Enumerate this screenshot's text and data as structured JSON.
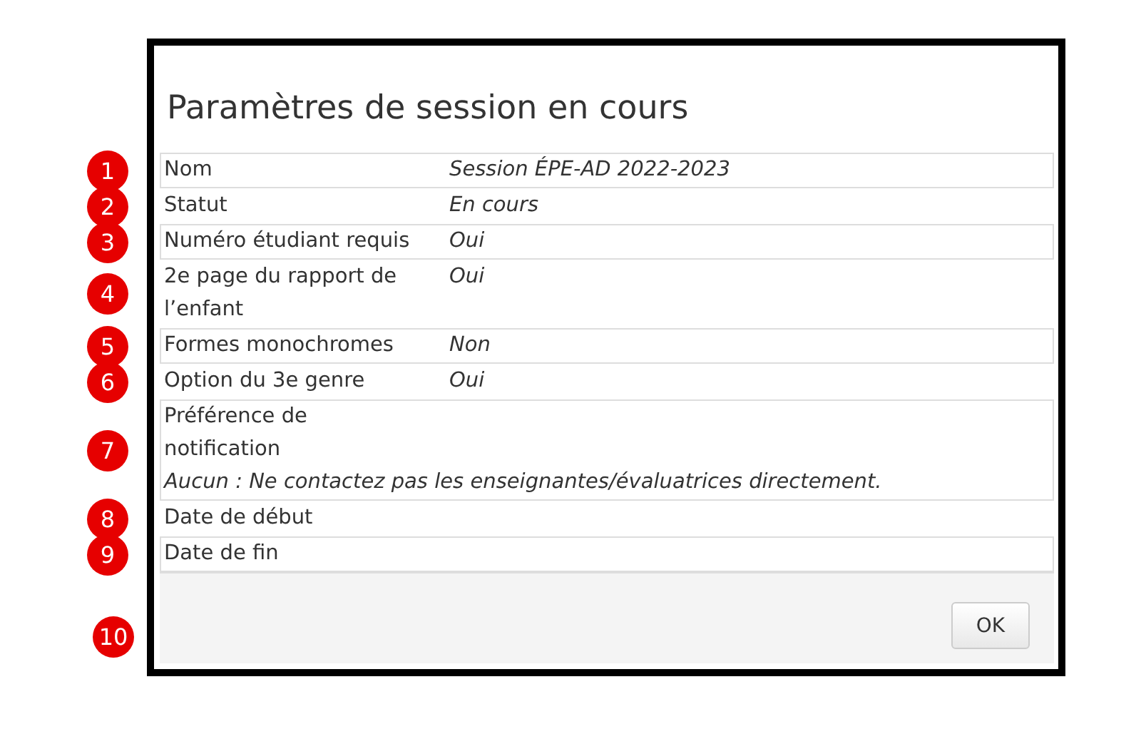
{
  "dialog": {
    "title": "Paramètres de session en cours",
    "rows": [
      {
        "marker": "1",
        "label": "Nom",
        "value": "Session ÉPE-AD 2022-2023",
        "kind": "inline"
      },
      {
        "marker": "2",
        "label": "Statut",
        "value": "En cours",
        "kind": "inline"
      },
      {
        "marker": "3",
        "label": "Numéro étudiant requis",
        "value": "Oui",
        "kind": "inline"
      },
      {
        "marker": "4",
        "label": "2e page du rapport de l’enfant",
        "value": "Oui",
        "kind": "inline"
      },
      {
        "marker": "5",
        "label": "Formes monochromes",
        "value": "Non",
        "kind": "inline"
      },
      {
        "marker": "6",
        "label": "Option du 3e genre",
        "value": "Oui",
        "kind": "inline"
      },
      {
        "marker": "7",
        "label": "Préférence de notification",
        "value": "Aucun : Ne contactez pas les enseignantes/évaluatrices directement.",
        "kind": "wide"
      },
      {
        "marker": "8",
        "label": "Date de début",
        "kind": "inline"
      },
      {
        "marker": "9",
        "label": "Date de fin",
        "kind": "inline"
      }
    ],
    "footer": {
      "marker": "10",
      "button": "OK"
    }
  }
}
